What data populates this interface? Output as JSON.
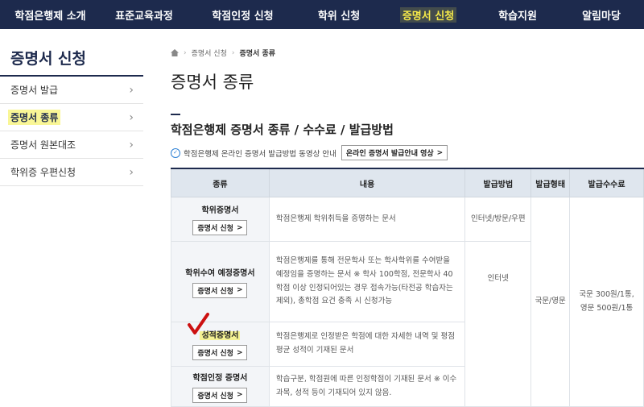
{
  "topnav": {
    "items": [
      {
        "label": "학점은행제 소개"
      },
      {
        "label": "표준교육과정"
      },
      {
        "label": "학점인정 신청"
      },
      {
        "label": "학위 신청"
      },
      {
        "label": "증명서 신청"
      },
      {
        "label": "학습지원"
      },
      {
        "label": "알림마당"
      }
    ]
  },
  "sidebar": {
    "title": "증명서 신청",
    "items": [
      {
        "label": "증명서 발급"
      },
      {
        "label": "증명서 종류"
      },
      {
        "label": "증명서 원본대조"
      },
      {
        "label": "학위증 우편신청"
      }
    ],
    "chevron": "›"
  },
  "breadcrumb": {
    "items": [
      "증명서 신청",
      "증명서 종류"
    ],
    "separator": "›"
  },
  "page": {
    "title": "증명서 종류",
    "section_title": "학점은행제 증명서 종류 / 수수료 / 발급방법",
    "info_text": "학점은행제 온라인 증명서 발급방법 동영상 안내",
    "video_button": "온라인 증명서 발급안내 영상",
    "button_arrow": ">"
  },
  "table": {
    "headers": [
      "종류",
      "내용",
      "발급방법",
      "발급형태",
      "발급수수료"
    ],
    "apply_button": "증명서 신청",
    "rows": [
      {
        "name": "학위증명서",
        "desc": "학점은행제 학위취득을 증명하는 문서",
        "method": "인터넷/방문/우편"
      },
      {
        "name": "학위수여 예정증명서",
        "desc": "학점은행제를 통해 전문학사 또는 학사학위를 수여받을 예정임을 증명하는 문서 ※ 학사 100학점, 전문학사 40학점 이상 인정되어있는 경우 접속가능(타전공 학습자는 제외), 총학점 요건 충족 시 신청가능",
        "method": "인터넷"
      },
      {
        "name": "성적증명서",
        "desc": "학점은행제로 인정받은 학점에 대한 자세한 내역 및 평점평균 성적이 기재된 문서"
      },
      {
        "name": "학점인정 증명서",
        "desc": "학습구분, 학점원에 따른 인정학점이 기재된 문서 ※ 이수과목, 성적 등이 기재되어 있지 않음."
      }
    ],
    "form": "국문/영문",
    "fee": "국문 300원/1통, 영문 500원/1통"
  },
  "colors": {
    "navy": "#1d2a4d",
    "highlight": "#f5f050",
    "check": "#cc1010"
  }
}
